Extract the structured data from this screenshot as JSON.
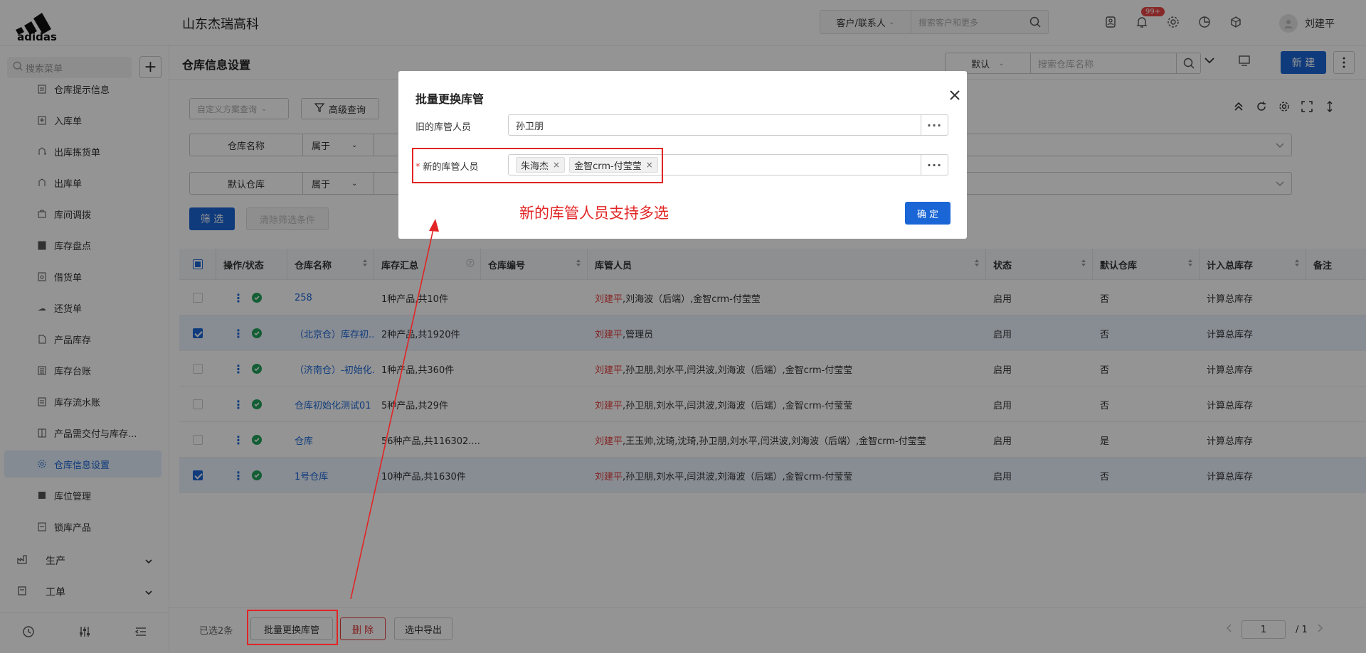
{
  "header": {
    "company": "山东杰瑞高科",
    "search_type": "客户/联系人",
    "search_placeholder": "搜索客户和更多",
    "notif_badge": "99+",
    "user_name": "刘建平"
  },
  "sidebar": {
    "search_placeholder": "搜索菜单",
    "items": [
      {
        "label": "仓库提示信息"
      },
      {
        "label": "入库单"
      },
      {
        "label": "出库拣货单"
      },
      {
        "label": "出库单"
      },
      {
        "label": "库间调拨"
      },
      {
        "label": "库存盘点"
      },
      {
        "label": "借货单"
      },
      {
        "label": "还货单"
      },
      {
        "label": "产品库存"
      },
      {
        "label": "库存台账"
      },
      {
        "label": "库存流水账"
      },
      {
        "label": "产品需交付与库存..."
      },
      {
        "label": "仓库信息设置"
      },
      {
        "label": "库位管理"
      },
      {
        "label": "锁库产品"
      }
    ],
    "groups": [
      {
        "label": "生产"
      },
      {
        "label": "工单"
      }
    ]
  },
  "page": {
    "title": "仓库信息设置",
    "view_type": "默认",
    "search_placeholder": "搜索仓库名称",
    "new_button": "新 建"
  },
  "filters": {
    "plan_placeholder": "自定义方案查询",
    "advanced": "高级查询",
    "rows": [
      {
        "field": "仓库名称",
        "op": "属于"
      },
      {
        "field": "默认仓库",
        "op": "属于"
      }
    ],
    "apply": "筛 选",
    "clear": "清除筛选条件"
  },
  "table": {
    "columns": [
      "操作/状态",
      "仓库名称",
      "库存汇总",
      "仓库编号",
      "库管人员",
      "状态",
      "默认仓库",
      "计入总库存",
      "备注"
    ],
    "rows": [
      {
        "name": "258",
        "summary": "1种产品,共10件",
        "code": "",
        "mgr_main": "刘建平",
        "mgr_rest": ",刘海波（后端）,金智crm-付莹莹",
        "status": "启用",
        "default": "否",
        "total": "计算总库存"
      },
      {
        "name": "（北京仓）库存初...",
        "summary": "2种产品,共1920件",
        "code": "",
        "mgr_main": "刘建平",
        "mgr_rest": ",管理员",
        "status": "启用",
        "default": "否",
        "total": "计算总库存"
      },
      {
        "name": "（济南仓）-初始化...",
        "summary": "1种产品,共360件",
        "code": "",
        "mgr_main": "刘建平",
        "mgr_rest": ",孙卫朋,刘水平,闫洪波,刘海波（后端）,金智crm-付莹莹",
        "status": "启用",
        "default": "否",
        "total": "计算总库存"
      },
      {
        "name": "仓库初始化测试01",
        "summary": "5种产品,共29件",
        "code": "",
        "mgr_main": "刘建平",
        "mgr_rest": ",孙卫朋,刘水平,闫洪波,刘海波（后端）,金智crm-付莹莹",
        "status": "启用",
        "default": "否",
        "total": "计算总库存"
      },
      {
        "name": "仓库",
        "summary": "56种产品,共116302....",
        "code": "",
        "mgr_main": "刘建平",
        "mgr_rest": ",王玉帅,沈琦,沈琦,孙卫朋,刘水平,闫洪波,刘海波（后端）,金智crm-付莹莹",
        "status": "启用",
        "default": "是",
        "total": "计算总库存"
      },
      {
        "name": "1号仓库",
        "summary": "10种产品,共1630件",
        "code": "",
        "mgr_main": "刘建平",
        "mgr_rest": ",孙卫朋,刘水平,闫洪波,刘海波（后端）,金智crm-付莹莹",
        "status": "启用",
        "default": "否",
        "total": "计算总库存"
      }
    ]
  },
  "footer": {
    "selected": "已选2条",
    "batch": "批量更换库管",
    "delete": "删 除",
    "export": "选中导出",
    "page": "1",
    "total_pages": "/ 1"
  },
  "modal": {
    "title": "批量更换库管",
    "old_label": "旧的库管人员",
    "old_value": "孙卫朋",
    "new_label": "新的库管人员",
    "new_tags": [
      "朱海杰",
      "金智crm-付莹莹"
    ],
    "hint": "新的库管人员支持多选",
    "ok": "确 定"
  },
  "colors": {
    "accent": "#1a66d6",
    "annotation": "#e22424",
    "status_ok": "#22a35a"
  }
}
